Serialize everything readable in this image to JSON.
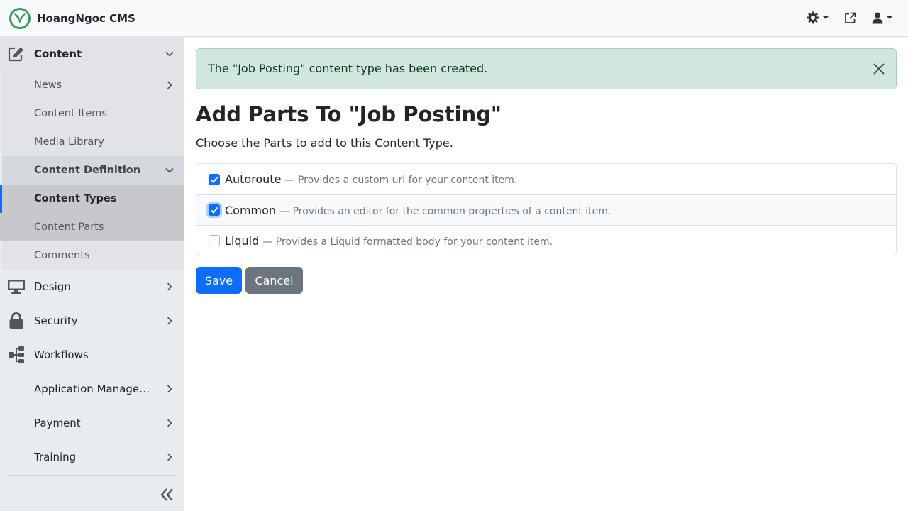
{
  "app": {
    "title": "HoangNgoc CMS"
  },
  "topbar": {
    "icons": [
      "theme-gear-icon",
      "external-link-icon",
      "user-icon"
    ]
  },
  "sidebar": {
    "items": [
      {
        "label": "Content",
        "icon": "edit-icon",
        "expanded": true
      },
      {
        "label": "News"
      },
      {
        "label": "Content Items"
      },
      {
        "label": "Media Library"
      },
      {
        "label": "Content Definition",
        "expanded": true
      },
      {
        "label": "Content Types",
        "active": true
      },
      {
        "label": "Content Parts"
      },
      {
        "label": "Comments"
      },
      {
        "label": "Design",
        "icon": "desktop-icon"
      },
      {
        "label": "Security",
        "icon": "lock-icon"
      },
      {
        "label": "Workflows",
        "icon": "sitemap-icon"
      },
      {
        "label": "Application Management"
      },
      {
        "label": "Payment"
      },
      {
        "label": "Training"
      }
    ]
  },
  "alert": {
    "message": "The \"Job Posting\" content type has been created."
  },
  "page": {
    "title": "Add Parts To \"Job Posting\"",
    "lead": "Choose the Parts to add to this Content Type."
  },
  "parts": [
    {
      "name": "Autoroute",
      "desc": "— Provides a custom url for your content item.",
      "checked": true
    },
    {
      "name": "Common",
      "desc": "— Provides an editor for the common properties of a content item.",
      "checked": true
    },
    {
      "name": "Liquid",
      "desc": "— Provides a Liquid formatted body for your content item.",
      "checked": false
    }
  ],
  "buttons": {
    "save": "Save",
    "cancel": "Cancel"
  },
  "colors": {
    "primary": "#0d6efd",
    "secondary": "#6c757d",
    "success_bg": "#d1e7dd",
    "brand_green": "#3a9a5b"
  }
}
